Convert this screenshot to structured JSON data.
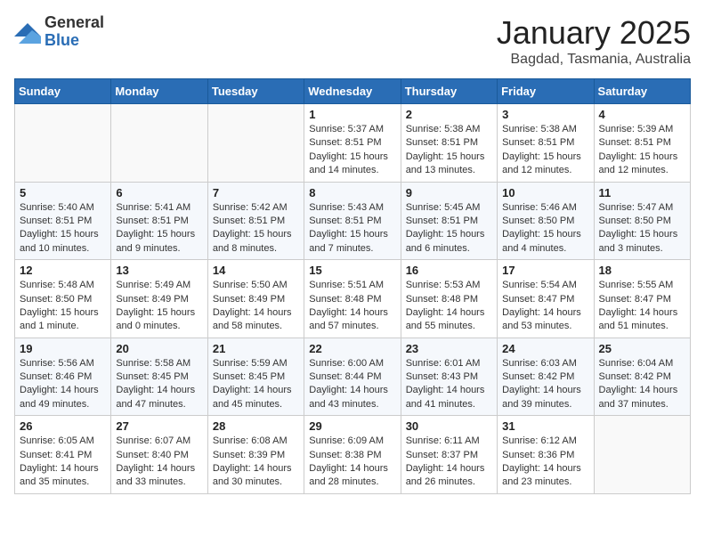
{
  "header": {
    "logo_general": "General",
    "logo_blue": "Blue",
    "month_title": "January 2025",
    "location": "Bagdad, Tasmania, Australia"
  },
  "days_of_week": [
    "Sunday",
    "Monday",
    "Tuesday",
    "Wednesday",
    "Thursday",
    "Friday",
    "Saturday"
  ],
  "weeks": [
    [
      {
        "day": "",
        "info": ""
      },
      {
        "day": "",
        "info": ""
      },
      {
        "day": "",
        "info": ""
      },
      {
        "day": "1",
        "info": "Sunrise: 5:37 AM\nSunset: 8:51 PM\nDaylight: 15 hours\nand 14 minutes."
      },
      {
        "day": "2",
        "info": "Sunrise: 5:38 AM\nSunset: 8:51 PM\nDaylight: 15 hours\nand 13 minutes."
      },
      {
        "day": "3",
        "info": "Sunrise: 5:38 AM\nSunset: 8:51 PM\nDaylight: 15 hours\nand 12 minutes."
      },
      {
        "day": "4",
        "info": "Sunrise: 5:39 AM\nSunset: 8:51 PM\nDaylight: 15 hours\nand 12 minutes."
      }
    ],
    [
      {
        "day": "5",
        "info": "Sunrise: 5:40 AM\nSunset: 8:51 PM\nDaylight: 15 hours\nand 10 minutes."
      },
      {
        "day": "6",
        "info": "Sunrise: 5:41 AM\nSunset: 8:51 PM\nDaylight: 15 hours\nand 9 minutes."
      },
      {
        "day": "7",
        "info": "Sunrise: 5:42 AM\nSunset: 8:51 PM\nDaylight: 15 hours\nand 8 minutes."
      },
      {
        "day": "8",
        "info": "Sunrise: 5:43 AM\nSunset: 8:51 PM\nDaylight: 15 hours\nand 7 minutes."
      },
      {
        "day": "9",
        "info": "Sunrise: 5:45 AM\nSunset: 8:51 PM\nDaylight: 15 hours\nand 6 minutes."
      },
      {
        "day": "10",
        "info": "Sunrise: 5:46 AM\nSunset: 8:50 PM\nDaylight: 15 hours\nand 4 minutes."
      },
      {
        "day": "11",
        "info": "Sunrise: 5:47 AM\nSunset: 8:50 PM\nDaylight: 15 hours\nand 3 minutes."
      }
    ],
    [
      {
        "day": "12",
        "info": "Sunrise: 5:48 AM\nSunset: 8:50 PM\nDaylight: 15 hours\nand 1 minute."
      },
      {
        "day": "13",
        "info": "Sunrise: 5:49 AM\nSunset: 8:49 PM\nDaylight: 15 hours\nand 0 minutes."
      },
      {
        "day": "14",
        "info": "Sunrise: 5:50 AM\nSunset: 8:49 PM\nDaylight: 14 hours\nand 58 minutes."
      },
      {
        "day": "15",
        "info": "Sunrise: 5:51 AM\nSunset: 8:48 PM\nDaylight: 14 hours\nand 57 minutes."
      },
      {
        "day": "16",
        "info": "Sunrise: 5:53 AM\nSunset: 8:48 PM\nDaylight: 14 hours\nand 55 minutes."
      },
      {
        "day": "17",
        "info": "Sunrise: 5:54 AM\nSunset: 8:47 PM\nDaylight: 14 hours\nand 53 minutes."
      },
      {
        "day": "18",
        "info": "Sunrise: 5:55 AM\nSunset: 8:47 PM\nDaylight: 14 hours\nand 51 minutes."
      }
    ],
    [
      {
        "day": "19",
        "info": "Sunrise: 5:56 AM\nSunset: 8:46 PM\nDaylight: 14 hours\nand 49 minutes."
      },
      {
        "day": "20",
        "info": "Sunrise: 5:58 AM\nSunset: 8:45 PM\nDaylight: 14 hours\nand 47 minutes."
      },
      {
        "day": "21",
        "info": "Sunrise: 5:59 AM\nSunset: 8:45 PM\nDaylight: 14 hours\nand 45 minutes."
      },
      {
        "day": "22",
        "info": "Sunrise: 6:00 AM\nSunset: 8:44 PM\nDaylight: 14 hours\nand 43 minutes."
      },
      {
        "day": "23",
        "info": "Sunrise: 6:01 AM\nSunset: 8:43 PM\nDaylight: 14 hours\nand 41 minutes."
      },
      {
        "day": "24",
        "info": "Sunrise: 6:03 AM\nSunset: 8:42 PM\nDaylight: 14 hours\nand 39 minutes."
      },
      {
        "day": "25",
        "info": "Sunrise: 6:04 AM\nSunset: 8:42 PM\nDaylight: 14 hours\nand 37 minutes."
      }
    ],
    [
      {
        "day": "26",
        "info": "Sunrise: 6:05 AM\nSunset: 8:41 PM\nDaylight: 14 hours\nand 35 minutes."
      },
      {
        "day": "27",
        "info": "Sunrise: 6:07 AM\nSunset: 8:40 PM\nDaylight: 14 hours\nand 33 minutes."
      },
      {
        "day": "28",
        "info": "Sunrise: 6:08 AM\nSunset: 8:39 PM\nDaylight: 14 hours\nand 30 minutes."
      },
      {
        "day": "29",
        "info": "Sunrise: 6:09 AM\nSunset: 8:38 PM\nDaylight: 14 hours\nand 28 minutes."
      },
      {
        "day": "30",
        "info": "Sunrise: 6:11 AM\nSunset: 8:37 PM\nDaylight: 14 hours\nand 26 minutes."
      },
      {
        "day": "31",
        "info": "Sunrise: 6:12 AM\nSunset: 8:36 PM\nDaylight: 14 hours\nand 23 minutes."
      },
      {
        "day": "",
        "info": ""
      }
    ]
  ]
}
